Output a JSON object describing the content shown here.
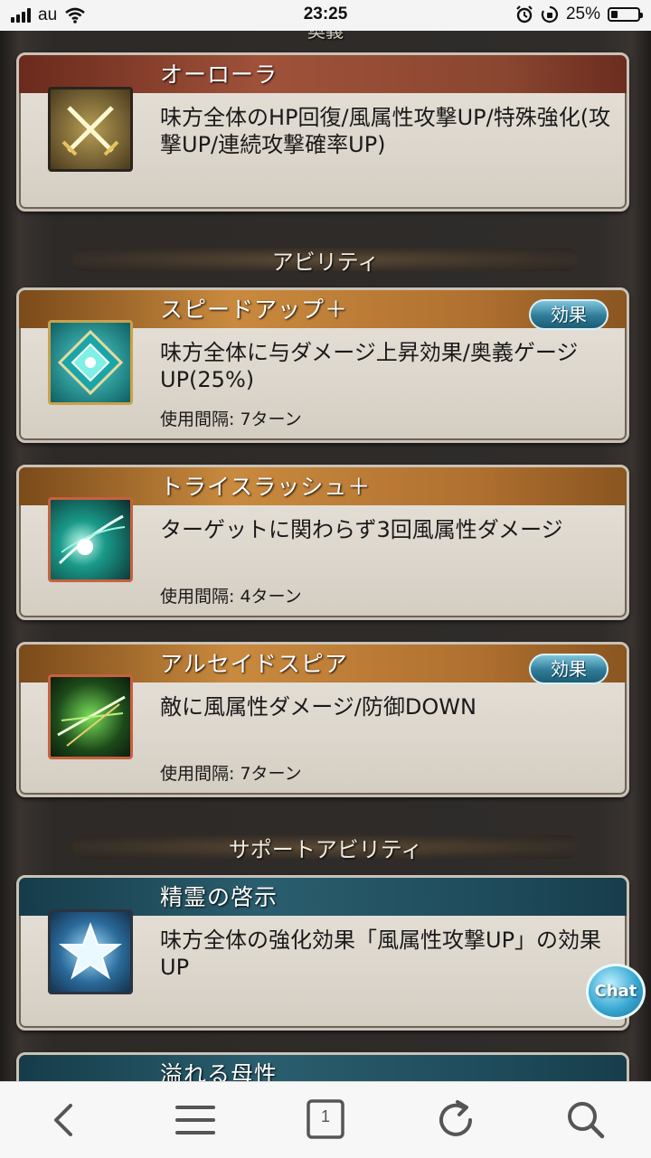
{
  "status_bar": {
    "carrier": "au",
    "time": "23:25",
    "battery_percent": "25%",
    "battery_level": 0.25
  },
  "top_partial_text": "奥義",
  "cards": [
    {
      "title": "オーローラ",
      "description": "味方全体のHP回復/風属性攻撃UP/特殊強化(攻撃UP/連続攻撃確率UP)",
      "icon": "crossed-swords-icon"
    },
    {
      "title": "スピードアップ＋",
      "description": "味方全体に与ダメージ上昇効果/奥義ゲージUP(25%)",
      "interval": "使用間隔: 7ターン",
      "badge": "効果",
      "icon": "diamond-crest-icon"
    },
    {
      "title": "トライスラッシュ＋",
      "description": "ターゲットに関わらず3回風属性ダメージ",
      "interval": "使用間隔: 4ターン",
      "icon": "wind-slash-icon"
    },
    {
      "title": "アルセイドスピア",
      "description": "敵に風属性ダメージ/防御DOWN",
      "interval": "使用間隔: 7ターン",
      "badge": "効果",
      "icon": "green-spear-icon"
    },
    {
      "title": "精霊の啓示",
      "description": "味方全体の強化効果「風属性攻撃UP」の効果UP",
      "icon": "star-icon"
    },
    {
      "title": "溢れる母性"
    }
  ],
  "sections": {
    "ability": "アビリティ",
    "support_ability": "サポートアビリティ"
  },
  "chat_button": "Chat",
  "bottom_nav": {
    "tab_count": "1",
    "icons": [
      "back-icon",
      "menu-icon",
      "tabs-icon",
      "reload-icon",
      "search-icon"
    ]
  }
}
